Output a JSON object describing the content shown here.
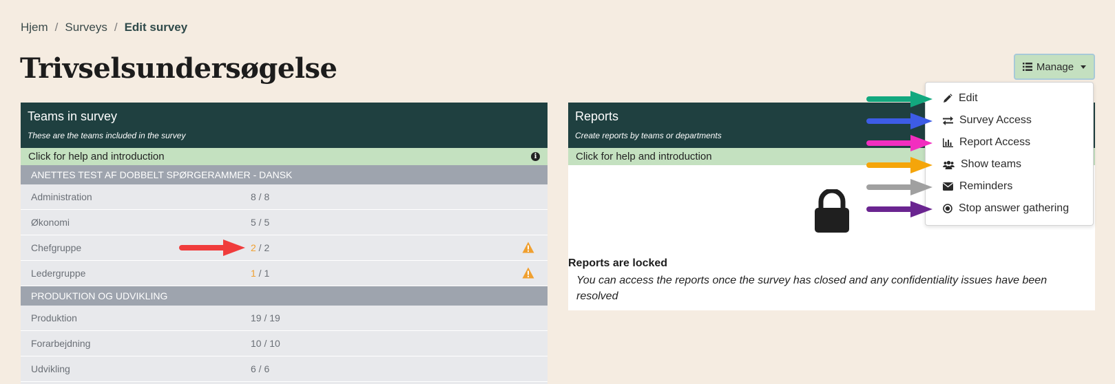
{
  "breadcrumb": {
    "home": "Hjem",
    "surveys": "Surveys",
    "current": "Edit survey"
  },
  "page_title": "Trivselsundersøgelse",
  "manage": {
    "label": "Manage"
  },
  "teams_card": {
    "title": "Teams in survey",
    "subtitle": "These are the teams included in the survey",
    "help": "Click for help and introduction",
    "groups": [
      {
        "name": "ANETTES TEST AF DOBBELT SPØRGERAMMER - DANSK",
        "teams": [
          {
            "name": "Administration",
            "answered": "8",
            "total": "8",
            "warning": false
          },
          {
            "name": "Økonomi",
            "answered": "5",
            "total": "5",
            "warning": false
          },
          {
            "name": "Chefgruppe",
            "answered": "2",
            "total": "2",
            "warning": true
          },
          {
            "name": "Ledergruppe",
            "answered": "1",
            "total": "1",
            "warning": true
          }
        ]
      },
      {
        "name": "PRODUKTION OG UDVIKLING",
        "teams": [
          {
            "name": "Produktion",
            "answered": "19",
            "total": "19",
            "warning": false
          },
          {
            "name": "Forarbejdning",
            "answered": "10",
            "total": "10",
            "warning": false
          },
          {
            "name": "Udvikling",
            "answered": "6",
            "total": "6",
            "warning": false
          }
        ]
      }
    ]
  },
  "reports_card": {
    "title": "Reports",
    "subtitle": "Create reports by teams or departments",
    "help": "Click for help and introduction",
    "locked_title": "Reports are locked",
    "locked_text": "You can access the reports once the survey has closed and any confidentiality issues have been resolved"
  },
  "manage_menu": {
    "items": [
      {
        "label": "Edit",
        "icon": "pencil-icon"
      },
      {
        "label": "Survey Access",
        "icon": "exchange-icon"
      },
      {
        "label": "Report Access",
        "icon": "bar-chart-icon"
      },
      {
        "label": "Show teams",
        "icon": "users-icon"
      },
      {
        "label": "Reminders",
        "icon": "envelope-icon"
      },
      {
        "label": "Stop answer gathering",
        "icon": "stop-circle-icon"
      }
    ]
  },
  "annotation_colors": {
    "edit": "#12a87e",
    "survey_access": "#3d5ce6",
    "report_access": "#f22ebf",
    "show_teams": "#f5a50a",
    "reminders": "#a0a0a0",
    "stop": "#6a2590",
    "warning": "#f03c3c"
  }
}
